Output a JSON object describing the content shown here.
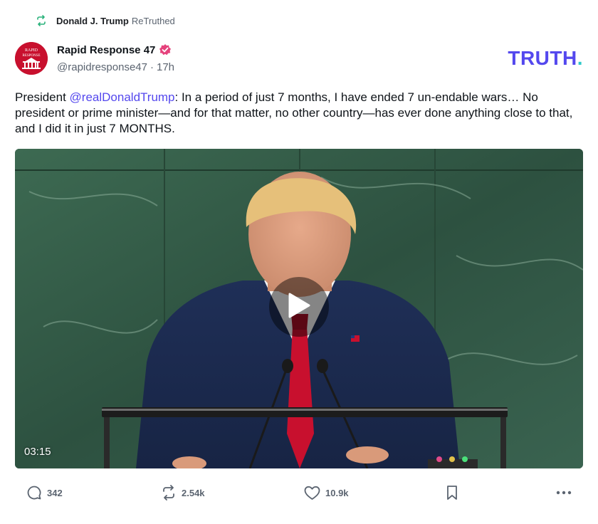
{
  "retruth": {
    "icon": "retruth-icon",
    "name": "Donald J. Trump",
    "label": "ReTruthed"
  },
  "author": {
    "avatar_text_top": "RAPID",
    "avatar_text_bottom": "RESPONSE",
    "display_name": "Rapid Response 47",
    "verified_icon": "verified-badge-icon",
    "handle": "@rapidresponse47",
    "separator": "·",
    "time": "17h"
  },
  "brand": {
    "logo_text": "TRUTH",
    "logo_dot": ".",
    "color": "#5448ee",
    "dot_color": "#2ec9c9"
  },
  "post": {
    "prefix": "President ",
    "mention": "@realDonaldTrump",
    "body": ": In a period of just 7 months, I have ended 7 un-endable wars… No president or prime minister—and for that matter, no other country—has ever done anything close to that, and I did it in just 7 MONTHS."
  },
  "media": {
    "play_icon": "play-icon",
    "duration": "03:15"
  },
  "actions": {
    "replies": {
      "icon": "reply-icon",
      "count": "342"
    },
    "retruths": {
      "icon": "retruth-icon",
      "count": "2.54k"
    },
    "likes": {
      "icon": "heart-icon",
      "count": "10.9k"
    },
    "bookmark": {
      "icon": "bookmark-icon"
    },
    "more": {
      "icon": "more-icon"
    }
  }
}
